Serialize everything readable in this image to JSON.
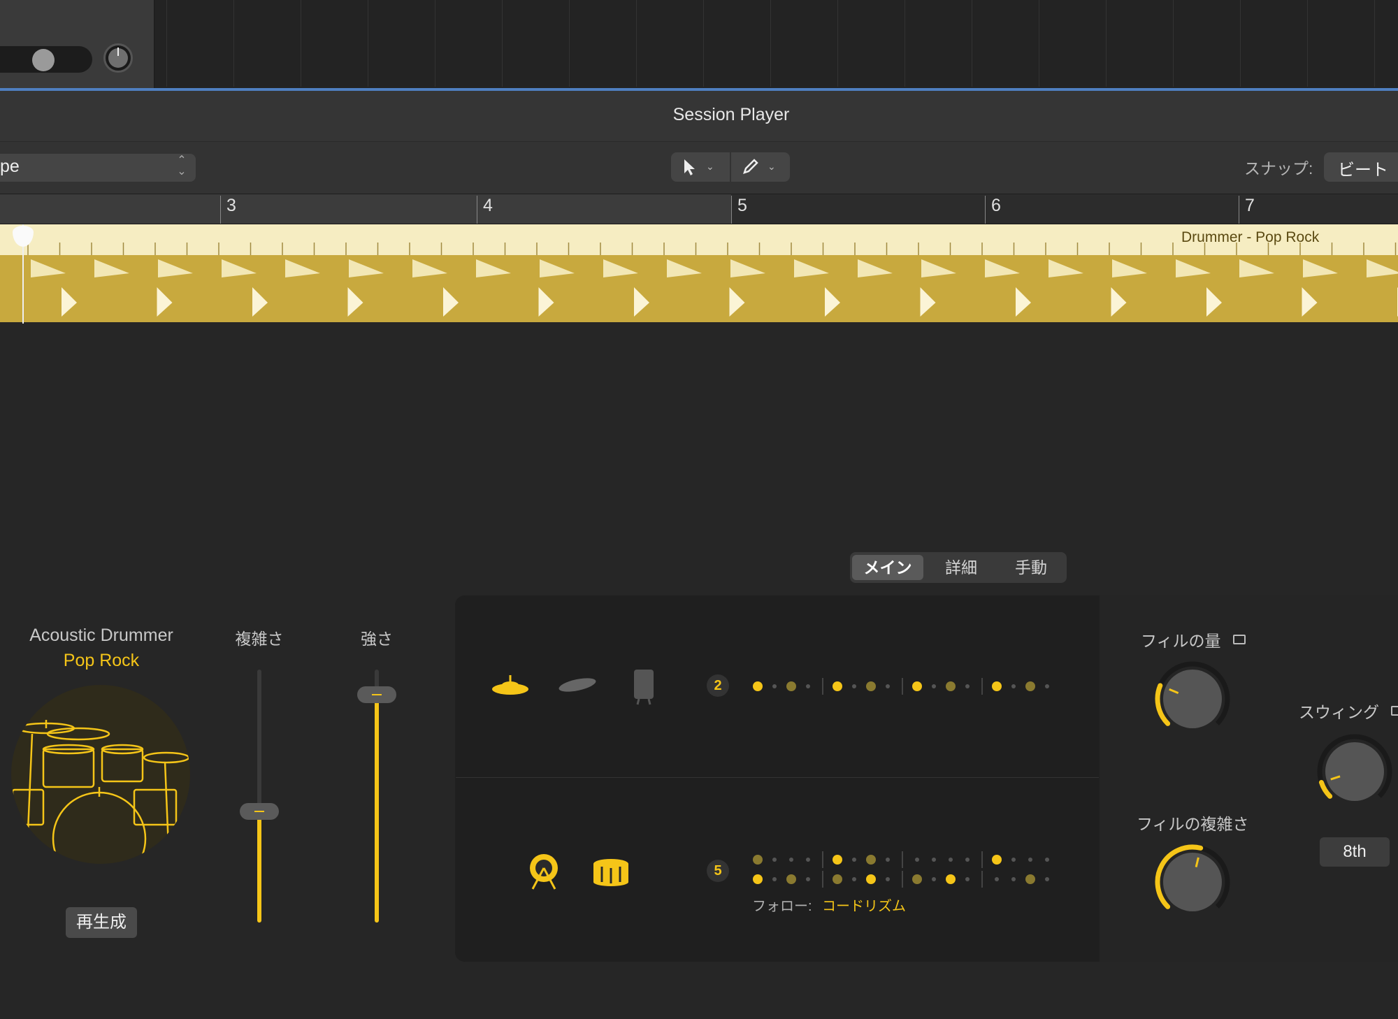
{
  "window": {
    "title": "Session Player"
  },
  "toolbar": {
    "select_value": "pe",
    "snap_label": "スナップ:",
    "snap_value": "ビート"
  },
  "ruler": {
    "bars": [
      "3",
      "4",
      "5",
      "6",
      "7"
    ]
  },
  "region": {
    "name": "Drummer - Pop Rock"
  },
  "drummer": {
    "name": "Acoustic Drummer",
    "genre": "Pop Rock",
    "regenerate_label": "再生成"
  },
  "sliders": {
    "complexity": {
      "label": "複雑さ",
      "level": 0.44
    },
    "loudness": {
      "label": "強さ",
      "level": 0.9
    }
  },
  "tabs": [
    {
      "label": "メイン",
      "selected": true
    },
    {
      "label": "詳細",
      "selected": false
    },
    {
      "label": "手動",
      "selected": false
    }
  ],
  "pattern": {
    "cymbals": {
      "count": "2",
      "icons": [
        "hihat-icon",
        "cymbal-icon",
        "shaker-icon"
      ]
    },
    "kick_snare": {
      "count": "5",
      "icons": [
        "kick-icon",
        "snare-icon"
      ]
    },
    "follow_label": "フォロー:",
    "follow_value": "コードリズム"
  },
  "knobs": {
    "fill_amount": {
      "label": "フィルの量",
      "value": 0.25
    },
    "fill_complexity": {
      "label": "フィルの複雑さ",
      "value": 0.55
    },
    "swing": {
      "label": "スウィング",
      "value": 0.1,
      "grid": "8th"
    }
  },
  "colors": {
    "accent": "#f5c518",
    "region": "#c8a93e",
    "region_header": "#f6edc2"
  }
}
